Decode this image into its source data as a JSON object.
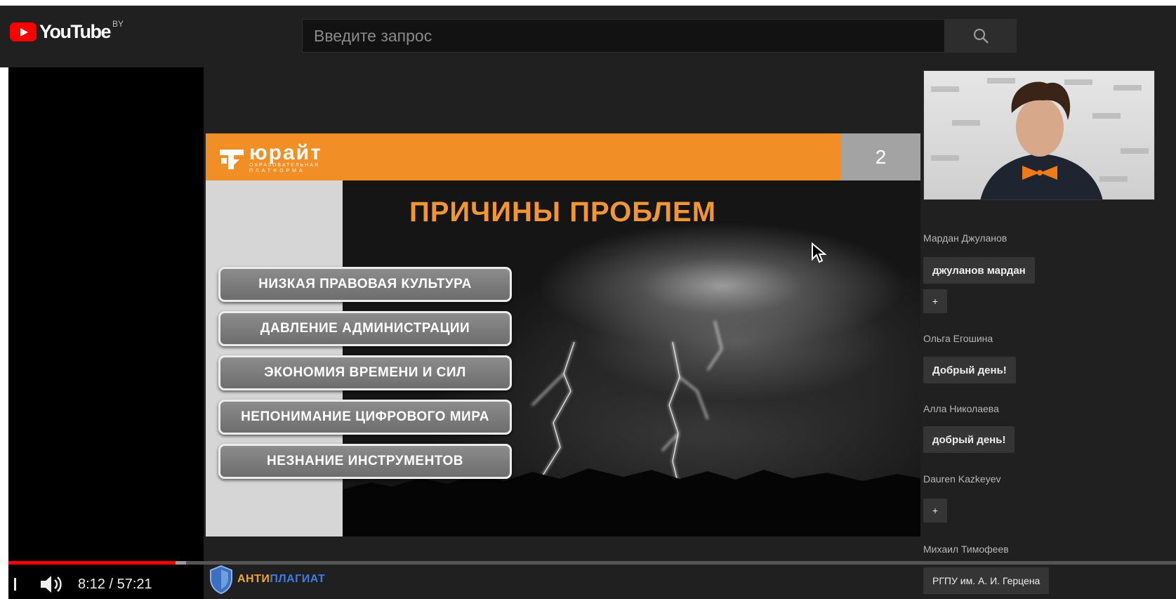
{
  "header": {
    "logo_text": "YouTube",
    "country": "BY",
    "search_placeholder": "Введите запрос"
  },
  "slide": {
    "logo_name": "юрайт",
    "logo_sub_1": "ОБРАЗОВАТЕЛЬНАЯ",
    "logo_sub_2": "ПЛАТФОРМА",
    "number": "2",
    "title": "ПРИЧИНЫ ПРОБЛЕМ",
    "reasons": [
      "НИЗКАЯ ПРАВОВАЯ КУЛЬТУРА",
      "ДАВЛЕНИЕ АДМИНИСТРАЦИИ",
      "ЭКОНОМИЯ ВРЕМЕНИ И СИЛ",
      "НЕПОНИМАНИЕ ЦИФРОВОГО МИРА",
      "НЕЗНАНИЕ ИНСТРУМЕНТОВ"
    ]
  },
  "chat": [
    {
      "name": "Мардан Джуланов",
      "message": "джуланов мардан"
    },
    {
      "name": "",
      "message": "+"
    },
    {
      "name": "Ольга Егошина",
      "message": "Добрый день!"
    },
    {
      "name": "Алла Николаева",
      "message": "добрый день!"
    },
    {
      "name": "Dauren Kazkeyev",
      "message": "+"
    },
    {
      "name": "Михаил Тимофеев",
      "message": "РГПУ им. А. И. Герцена"
    }
  ],
  "player": {
    "current_time": "8:12",
    "duration": "57:21",
    "time_display": "8:12 / 57:21",
    "progress_fraction": 0.143
  },
  "watermark": {
    "brand_part1": "АНТИ",
    "brand_part2": "ПЛАГИАТ"
  },
  "colors": {
    "youtube_red": "#ff0000",
    "slide_orange": "#f18e26",
    "title_orange": "#f29633",
    "topbar": "#202020"
  }
}
